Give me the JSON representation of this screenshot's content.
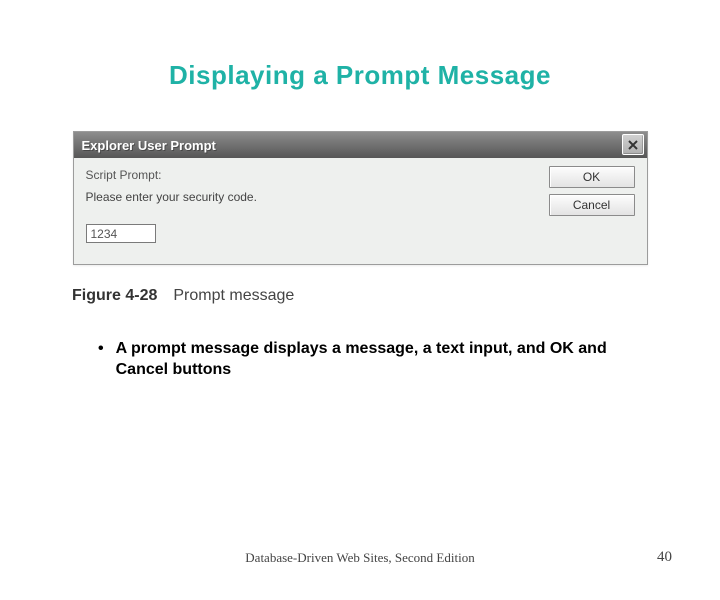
{
  "title": "Displaying a Prompt Message",
  "dialog": {
    "window_title": "Explorer User Prompt",
    "script_prompt_label": "Script Prompt:",
    "prompt_text": "Please enter your security code.",
    "input_value": "1234",
    "ok_label": "OK",
    "cancel_label": "Cancel"
  },
  "figure": {
    "number": "Figure 4-28",
    "caption": "Prompt message"
  },
  "bullet": "A prompt message displays a message, a text input, and OK and Cancel buttons",
  "footer": {
    "source": "Database-Driven Web Sites, Second Edition",
    "page": "40"
  }
}
